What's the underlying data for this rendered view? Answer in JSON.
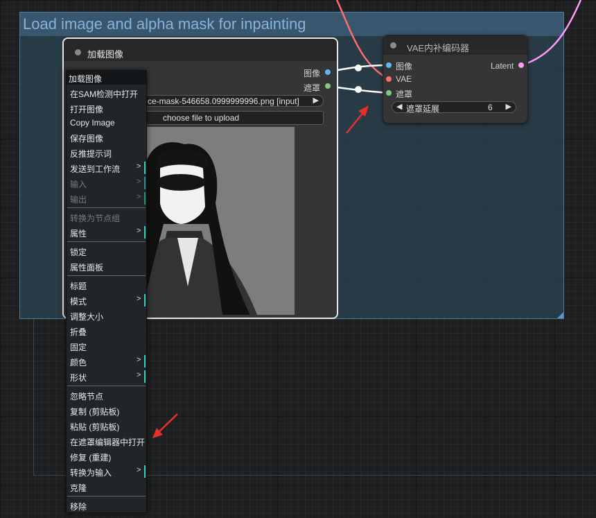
{
  "group": {
    "title": "Load image and alpha mask for inpainting"
  },
  "load_node": {
    "title": "加载图像",
    "outputs": [
      {
        "label": "图像",
        "color": "#64b5f6"
      },
      {
        "label": "遮罩",
        "color": "#81c784"
      }
    ],
    "file_widget": {
      "prev": "◀",
      "value": "ce-mask-546658.0999999996.png [input]",
      "next": "▶"
    },
    "upload_label": "choose file to upload"
  },
  "vae_node": {
    "title": "VAE内补编码器",
    "inputs": [
      {
        "label": "图像",
        "color": "#64b5f6"
      },
      {
        "label": "VAE",
        "color": "#ff6e6e"
      },
      {
        "label": "遮罩",
        "color": "#81c784"
      }
    ],
    "output": {
      "label": "Latent",
      "color": "#ff9cf9"
    },
    "grow_widget": {
      "prev": "◀",
      "label": "遮罩延展",
      "value": "6",
      "next": "▶"
    }
  },
  "context_menu": {
    "items": [
      {
        "label": "加载图像",
        "kind": "header"
      },
      {
        "label": "在SAM检测中打开"
      },
      {
        "label": "打开图像"
      },
      {
        "label": "Copy Image"
      },
      {
        "label": "保存图像"
      },
      {
        "label": "反推提示词"
      },
      {
        "label": "发送到工作流",
        "submenu": true
      },
      {
        "label": "输入",
        "submenu": true,
        "disabled": true
      },
      {
        "label": "输出",
        "submenu": true,
        "disabled": true
      },
      {
        "separator": true
      },
      {
        "label": "转换为节点组",
        "disabled": true
      },
      {
        "label": "属性",
        "submenu": true
      },
      {
        "separator": true
      },
      {
        "label": "锁定"
      },
      {
        "label": "属性面板"
      },
      {
        "separator": true
      },
      {
        "label": "标题"
      },
      {
        "label": "模式",
        "submenu": true
      },
      {
        "label": "调整大小"
      },
      {
        "label": "折叠"
      },
      {
        "label": "固定"
      },
      {
        "label": "颜色",
        "submenu": true
      },
      {
        "label": "形状",
        "submenu": true
      },
      {
        "separator": true
      },
      {
        "label": "忽略节点"
      },
      {
        "label": "复制 (剪贴板)"
      },
      {
        "label": "粘贴 (剪贴板)"
      },
      {
        "label": "在遮罩编辑器中打开"
      },
      {
        "label": "修复 (重建)"
      },
      {
        "label": "转换为输入",
        "submenu": true
      },
      {
        "label": "克隆"
      },
      {
        "separator": true
      },
      {
        "label": "移除"
      }
    ],
    "submenu_arrow": ">"
  },
  "colors": {
    "link_vae": "#ff6e6e",
    "link_latent": "#ff9cf9",
    "link_white": "#ffffff",
    "annotation_arrow": "#e8302a",
    "submenu_accent": "#2fd1bb"
  }
}
